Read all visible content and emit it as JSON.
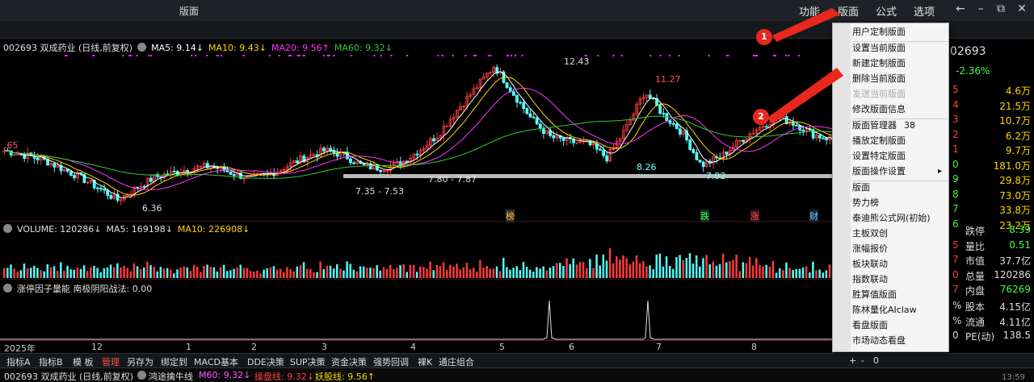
{
  "window": {
    "title": "版面"
  },
  "menu": {
    "items": [
      "功能",
      "版面",
      "公式",
      "选项"
    ]
  },
  "window_controls": {
    "back": "←",
    "minimize": "–",
    "restore": "⧉",
    "close": "✕"
  },
  "main_header": {
    "stock": "002693 双成药业 (日线,前复权)",
    "ma5": "MA5: 9.14↓",
    "ma10": "MA10: 9.43↓",
    "ma20": "MA20: 9.56↑",
    "ma60": "MA60: 9.32↓"
  },
  "price_labels": {
    "high": "12.43",
    "peak2": "11.27",
    "left_edge": ".65",
    "low1": "6.36",
    "support1": "7.35 - 7.53",
    "support2": "7.80 - 7.87",
    "low2": "8.26",
    "low3": "7.92"
  },
  "event_tags": {
    "bang": "榜",
    "die": "跌",
    "zhang": "涨",
    "cai": "财"
  },
  "volume_header": {
    "volume": "VOLUME: 120286↓",
    "ma5": "MA5: 169198↓",
    "ma10": "MA10: 226908↓"
  },
  "indicator_header": {
    "text": "涨停因子量能  南极阴阳战法: 0.00"
  },
  "date_axis": {
    "labels": [
      "2025年",
      "12",
      "1",
      "2",
      "3",
      "4",
      "5",
      "6",
      "7",
      "8"
    ]
  },
  "toolbar": {
    "items": [
      "指标A",
      "指标B",
      "模 板",
      "管理",
      "另存为",
      "绑定到",
      "MACD基本",
      "DDE决策",
      "SUP决策",
      "资金决策",
      "强势回调",
      "裸K",
      "通庄组合"
    ],
    "right": [
      "+",
      "-",
      "0"
    ]
  },
  "statusbar": {
    "stock": "002693 双成药业 (日线,前复权)",
    "line1": "鸿途擒牛线",
    "m60": "M60: 9.32↓",
    "pan": "操盘线: 9.32↓",
    "yao": "妖股线: 9.56↑",
    "time": "13:59"
  },
  "right_panel": {
    "code": "02693",
    "change": "-2.36%",
    "values": [
      "4.6万",
      "21.5万",
      "10.7万",
      "6.2万",
      "9.7万",
      "181.0万",
      "29.8万",
      "73.0万",
      "33.8万",
      "23.2万"
    ],
    "left_digits": [
      "5",
      "4",
      "3",
      "2",
      "1",
      "0",
      "9",
      "8",
      "7",
      "6"
    ],
    "stats": [
      {
        "k": "跌停",
        "v": "8.39"
      },
      {
        "k": "量比",
        "v": "0.51"
      },
      {
        "k": "市值",
        "v": "37.7亿"
      },
      {
        "k": "总量",
        "v": "120286"
      },
      {
        "k": "内盘",
        "v": "76269"
      }
    ],
    "stats2": [
      {
        "k": "股本",
        "v": "4.15亿"
      },
      {
        "k": "流通",
        "v": "4.11亿"
      },
      {
        "k": "PE(动)",
        "v": "138.5"
      }
    ],
    "stat_prefix": [
      "5",
      "7",
      "0",
      "7"
    ],
    "stat2_prefix": [
      "%",
      "%",
      "0"
    ]
  },
  "dropdown": {
    "items": [
      {
        "label": "用户定制版面",
        "disabled": false
      },
      {
        "label": "设置当前版面",
        "disabled": false
      },
      {
        "label": "新建定制版面",
        "disabled": false
      },
      {
        "label": "删除当前版面",
        "disabled": false
      },
      {
        "label": "发送当前版面",
        "disabled": true
      },
      {
        "label": "修改版面信息",
        "disabled": false
      },
      {
        "label": "版面管理器",
        "disabled": false,
        "count": "38"
      },
      {
        "label": "播放定制版面",
        "disabled": false
      },
      {
        "label": "设置特定版面",
        "disabled": false
      },
      {
        "label": "版面操作设置",
        "disabled": false,
        "submenu": "▸"
      },
      {
        "label": "版面",
        "disabled": false
      },
      {
        "label": "势力榜",
        "disabled": false
      },
      {
        "label": "泰迪熊公式网(初始)",
        "disabled": false
      },
      {
        "label": "主板双创",
        "disabled": false
      },
      {
        "label": "涨幅报价",
        "disabled": false
      },
      {
        "label": "板块联动",
        "disabled": false
      },
      {
        "label": "指数联动",
        "disabled": false
      },
      {
        "label": "胜算值版面",
        "disabled": false
      },
      {
        "label": "陈林量化AIclaw",
        "disabled": false
      },
      {
        "label": "看盘版面",
        "disabled": false
      },
      {
        "label": "市场动态看盘",
        "disabled": false
      }
    ]
  },
  "annotations": {
    "badge1": "1",
    "badge2": "2"
  },
  "colors": {
    "up": "#ff3b3b",
    "down": "#54ffff",
    "ma5": "#ffffff",
    "ma10": "#ffd700",
    "ma20": "#ff33ff",
    "ma60": "#33cc33",
    "accent_red": "#e8281e"
  },
  "chart_data": {
    "type": "candlestick",
    "x": [
      "2025年",
      "12",
      "1",
      "2",
      "3",
      "4",
      "5",
      "6",
      "7",
      "8"
    ],
    "series": [
      {
        "name": "MA5",
        "values": [
          9.14
        ]
      },
      {
        "name": "MA10",
        "values": [
          9.43
        ]
      },
      {
        "name": "MA20",
        "values": [
          9.56
        ]
      },
      {
        "name": "MA60",
        "values": [
          9.32
        ]
      }
    ],
    "price_path": [
      8.6,
      8.4,
      8.2,
      7.8,
      7.4,
      6.9,
      6.36,
      6.9,
      7.4,
      7.6,
      7.8,
      7.9,
      7.6,
      7.35,
      7.5,
      7.9,
      8.3,
      8.6,
      8.4,
      7.9,
      7.8,
      8.0,
      8.6,
      9.3,
      10.4,
      11.4,
      12.43,
      11.2,
      10.0,
      9.2,
      9.0,
      8.9,
      8.26,
      9.6,
      11.27,
      10.2,
      9.4,
      7.92,
      8.3,
      9.0,
      9.6,
      10.1,
      9.8,
      9.3,
      9.1
    ],
    "ylim": [
      6.0,
      13.0
    ],
    "volume": {
      "last": 120286,
      "ma5": 169198,
      "ma10": 226908
    }
  }
}
